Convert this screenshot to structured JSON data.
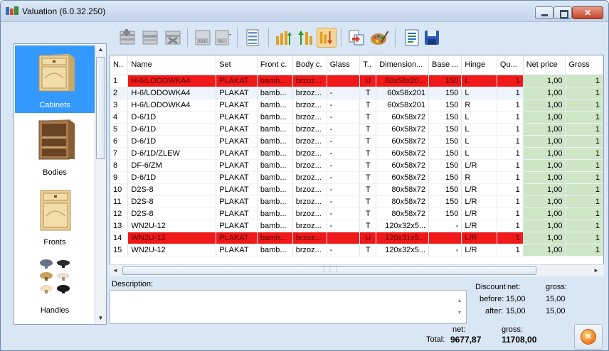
{
  "window": {
    "title": "Valuation (6.0.32.250)"
  },
  "categories": [
    {
      "label": "Cabinets",
      "selected": true
    },
    {
      "label": "Bodies",
      "selected": false
    },
    {
      "label": "Fronts",
      "selected": false
    },
    {
      "label": "Handles",
      "selected": false
    }
  ],
  "toolbar": {
    "icons": [
      "add-row-icon",
      "edit-row-icon",
      "delete-row-icon",
      "number-icon",
      "percent-icon",
      "list-icon",
      "sort-up-icon",
      "sort-up-alt-icon",
      "sort-down-icon",
      "export-icon",
      "palette-icon",
      "report-icon",
      "save-icon"
    ]
  },
  "grid": {
    "columns": [
      "N..",
      "Name",
      "Set",
      "Front c.",
      "Body c.",
      "Glass",
      "T..",
      "Dimension...",
      "Base ...",
      "Hinge",
      "Qu...",
      "Net price",
      "Gross"
    ],
    "rows": [
      {
        "n": "1",
        "name": "H-6/LODOWKA4",
        "set": "PLAKAT",
        "front": "bamb...",
        "body": "brzoz...",
        "glass": "",
        "t": "U",
        "dim": "60x58x20...",
        "base": "150",
        "hinge": "L",
        "qty": "1",
        "net": "1,00",
        "gross": "1",
        "error": true
      },
      {
        "n": "2",
        "name": "H-6/LODOWKA4",
        "set": "PLAKAT",
        "front": "bamb...",
        "body": "brzoz...",
        "glass": "-",
        "t": "T",
        "dim": "60x58x201",
        "base": "150",
        "hinge": "L",
        "qty": "1",
        "net": "1,00",
        "gross": "1",
        "selected": true
      },
      {
        "n": "3",
        "name": "H-6/LODOWKA4",
        "set": "PLAKAT",
        "front": "bamb...",
        "body": "brzoz...",
        "glass": "-",
        "t": "T",
        "dim": "60x58x201",
        "base": "150",
        "hinge": "R",
        "qty": "1",
        "net": "1,00",
        "gross": "1"
      },
      {
        "n": "4",
        "name": "D-6/1D",
        "set": "PLAKAT",
        "front": "bamb...",
        "body": "brzoz...",
        "glass": "-",
        "t": "T",
        "dim": "60x58x72",
        "base": "150",
        "hinge": "L",
        "qty": "1",
        "net": "1,00",
        "gross": "1"
      },
      {
        "n": "5",
        "name": "D-6/1D",
        "set": "PLAKAT",
        "front": "bamb...",
        "body": "brzoz...",
        "glass": "-",
        "t": "T",
        "dim": "60x58x72",
        "base": "150",
        "hinge": "L",
        "qty": "1",
        "net": "1,00",
        "gross": "1"
      },
      {
        "n": "6",
        "name": "D-6/1D",
        "set": "PLAKAT",
        "front": "bamb...",
        "body": "brzoz...",
        "glass": "-",
        "t": "T",
        "dim": "60x58x72",
        "base": "150",
        "hinge": "L",
        "qty": "1",
        "net": "1,00",
        "gross": "1"
      },
      {
        "n": "7",
        "name": "D-6/1D/ZLEW",
        "set": "PLAKAT",
        "front": "bamb...",
        "body": "brzoz...",
        "glass": "-",
        "t": "T",
        "dim": "60x58x72",
        "base": "150",
        "hinge": "L",
        "qty": "1",
        "net": "1,00",
        "gross": "1"
      },
      {
        "n": "8",
        "name": "DF-6/ZM",
        "set": "PLAKAT",
        "front": "bamb...",
        "body": "brzoz...",
        "glass": "-",
        "t": "T",
        "dim": "60x58x72",
        "base": "150",
        "hinge": "L/R",
        "qty": "1",
        "net": "1,00",
        "gross": "1"
      },
      {
        "n": "9",
        "name": "D-6/1D",
        "set": "PLAKAT",
        "front": "bamb...",
        "body": "brzoz...",
        "glass": "-",
        "t": "T",
        "dim": "60x58x72",
        "base": "150",
        "hinge": "R",
        "qty": "1",
        "net": "1,00",
        "gross": "1"
      },
      {
        "n": "10",
        "name": "D2S-8",
        "set": "PLAKAT",
        "front": "bamb...",
        "body": "brzoz...",
        "glass": "-",
        "t": "T",
        "dim": "80x58x72",
        "base": "150",
        "hinge": "L/R",
        "qty": "1",
        "net": "1,00",
        "gross": "1"
      },
      {
        "n": "11",
        "name": "D2S-8",
        "set": "PLAKAT",
        "front": "bamb...",
        "body": "brzoz...",
        "glass": "-",
        "t": "T",
        "dim": "80x58x72",
        "base": "150",
        "hinge": "L/R",
        "qty": "1",
        "net": "1,00",
        "gross": "1"
      },
      {
        "n": "12",
        "name": "D2S-8",
        "set": "PLAKAT",
        "front": "bamb...",
        "body": "brzoz...",
        "glass": "-",
        "t": "T",
        "dim": "80x58x72",
        "base": "150",
        "hinge": "L/R",
        "qty": "1",
        "net": "1,00",
        "gross": "1"
      },
      {
        "n": "13",
        "name": "WN2U-12",
        "set": "PLAKAT",
        "front": "bamb...",
        "body": "brzoz...",
        "glass": "-",
        "t": "T",
        "dim": "120x32x5...",
        "base": "-",
        "hinge": "L/R",
        "qty": "1",
        "net": "1,00",
        "gross": "1"
      },
      {
        "n": "14",
        "name": "WN2U-12",
        "set": "PLAKAT",
        "front": "bamb...",
        "body": "brzoz...",
        "glass": "",
        "t": "U",
        "dim": "120x31x5...",
        "base": "",
        "hinge": "L/R",
        "qty": "1",
        "net": "1,00",
        "gross": "1",
        "error": true
      },
      {
        "n": "15",
        "name": "WN2U-12",
        "set": "PLAKAT",
        "front": "bamb...",
        "body": "brzoz...",
        "glass": "-",
        "t": "T",
        "dim": "120x32x5...",
        "base": "-",
        "hinge": "L/R",
        "qty": "1",
        "net": "1,00",
        "gross": "1"
      }
    ]
  },
  "description": {
    "label": "Description:",
    "value": ""
  },
  "discount": {
    "label": "Discount",
    "net_label": "net:",
    "gross_label": "gross:",
    "before_label": "before:",
    "after_label": "after:",
    "before_net": "15,00",
    "before_gross": "15,00",
    "after_net": "15,00",
    "after_gross": "15,00"
  },
  "totals": {
    "label": "Total:",
    "net_label": "net:",
    "gross_label": "gross:",
    "net": "9677,87",
    "gross": "11708,00"
  },
  "colors": {
    "error_row": "#f01919",
    "price_cell": "#cde6c6",
    "selected_category": "#3399ff"
  }
}
